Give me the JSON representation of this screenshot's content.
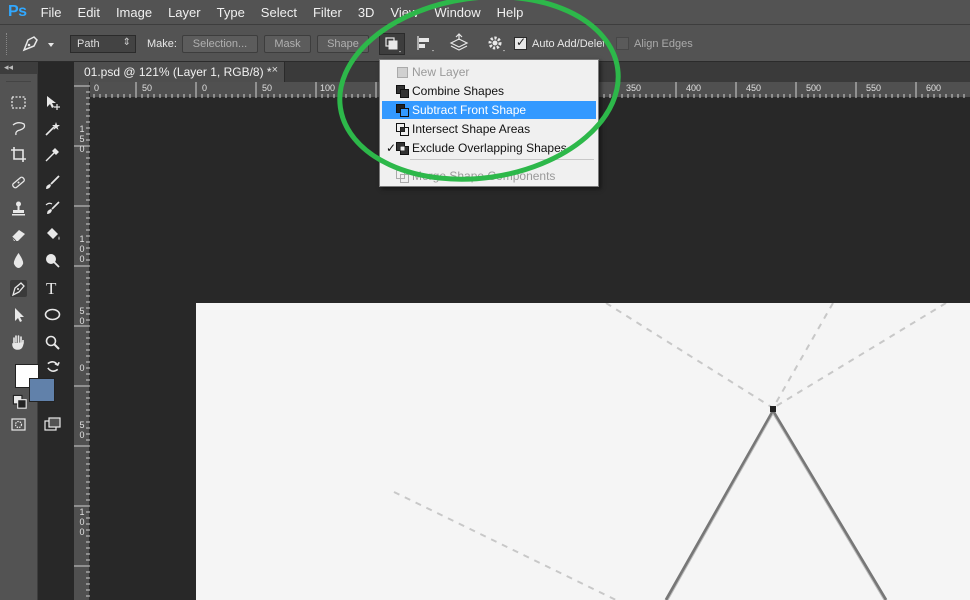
{
  "app": {
    "logo": "Ps"
  },
  "menu": [
    "File",
    "Edit",
    "Image",
    "Layer",
    "Type",
    "Select",
    "Filter",
    "3D",
    "View",
    "Window",
    "Help"
  ],
  "options_bar": {
    "mode_value": "Path",
    "make_label": "Make:",
    "selection_button": "Selection...",
    "mask_button": "Mask",
    "shape_button": "Shape",
    "auto_add_delete_label": "Auto Add/Delete",
    "auto_add_delete_checked": true,
    "align_edges_label": "Align Edges",
    "align_edges_checked": false
  },
  "document_tab": {
    "title": "01.psd @ 121% (Layer 1, RGB/8) *",
    "close": "×"
  },
  "ruler_top_labels": [
    "0",
    "50",
    "0",
    "50",
    "100",
    "350",
    "400",
    "450",
    "500",
    "550",
    "600"
  ],
  "ruler_left_labels": [
    "150",
    "100",
    "50",
    "0",
    "50",
    "100"
  ],
  "colors": {
    "foreground": "#ffffff",
    "background": "#6181aa",
    "highlight": "#3399ff",
    "annotation": "#2db84a"
  },
  "path_operations_menu": {
    "items": [
      {
        "label": "New Layer",
        "enabled": false,
        "checked": false,
        "highlighted": false,
        "icon": "new-layer-icon"
      },
      {
        "label": "Combine Shapes",
        "enabled": true,
        "checked": false,
        "highlighted": false,
        "icon": "combine-shapes-icon"
      },
      {
        "label": "Subtract Front Shape",
        "enabled": true,
        "checked": false,
        "highlighted": true,
        "icon": "subtract-front-shape-icon"
      },
      {
        "label": "Intersect Shape Areas",
        "enabled": true,
        "checked": false,
        "highlighted": false,
        "icon": "intersect-shape-areas-icon"
      },
      {
        "label": "Exclude Overlapping Shapes",
        "enabled": true,
        "checked": true,
        "highlighted": false,
        "icon": "exclude-overlapping-shapes-icon"
      },
      {
        "label": "Merge Shape Components",
        "enabled": false,
        "checked": false,
        "highlighted": false,
        "icon": "merge-shape-components-icon"
      }
    ],
    "check_mark": "✓"
  },
  "toolbar": {
    "collapse": "◂◂",
    "tools": [
      "marquee-tool",
      "move-tool",
      "lasso-tool",
      "magic-wand-tool",
      "crop-tool",
      "eyedropper-tool",
      "healing-brush-tool",
      "brush-tool",
      "clone-stamp-tool",
      "history-brush-tool",
      "eraser-tool",
      "paint-bucket-tool",
      "blur-tool",
      "dodge-tool",
      "pen-tool",
      "type-tool",
      "path-selection-tool",
      "ellipse-tool",
      "hand-tool",
      "zoom-tool"
    ],
    "selected_tool": "pen-tool",
    "type_tool_glyph": "T"
  }
}
